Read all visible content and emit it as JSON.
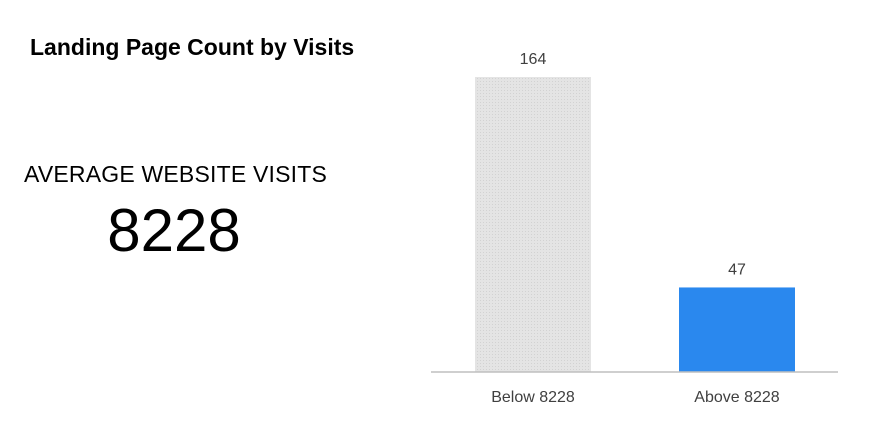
{
  "title": "Landing Page Count by Visits",
  "kpi": {
    "label": "AVERAGE WEBSITE VISITS",
    "value": "8228"
  },
  "colors": {
    "below_bar": "#e0e0e0",
    "above_bar": "#2a88ee",
    "axis": "#bfbfbf",
    "labels": "#404040"
  },
  "chart_data": {
    "type": "bar",
    "categories": [
      "Below 8228",
      "Above 8228"
    ],
    "values": [
      164,
      47
    ],
    "data_labels": [
      "164",
      "47"
    ],
    "title": "",
    "xlabel": "",
    "ylabel": "",
    "ylim": [
      0,
      164
    ],
    "grid": false,
    "legend": "none"
  }
}
